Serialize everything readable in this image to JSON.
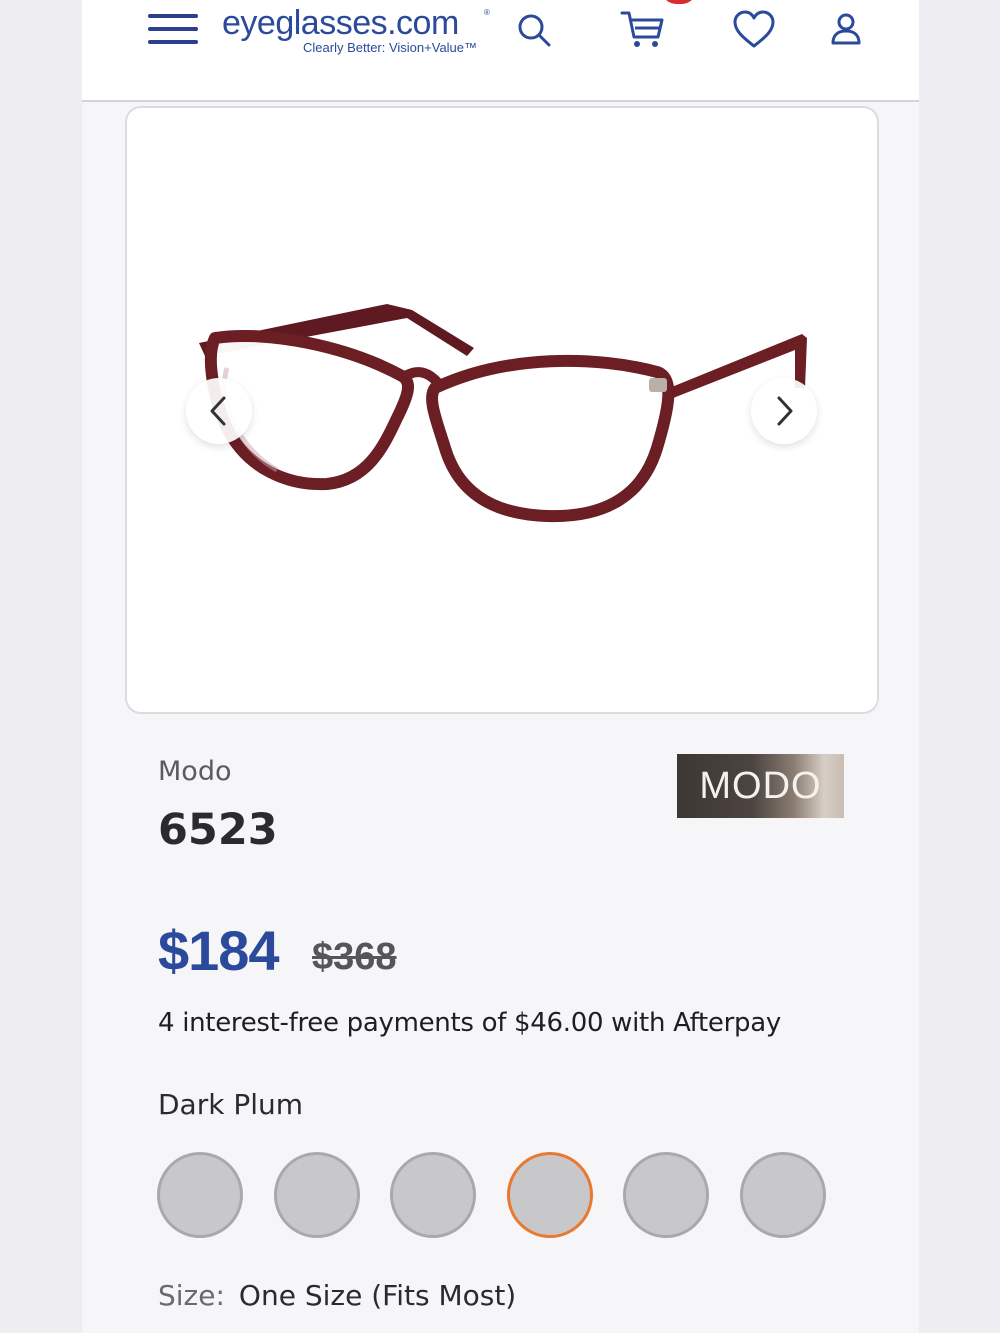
{
  "header": {
    "logo_text": "eyeglasses.com",
    "logo_reg": "®",
    "tagline": "Clearly Better: Vision+Value™"
  },
  "icons": {
    "menu": "menu-icon",
    "search": "search-icon",
    "cart": "cart-icon",
    "wishlist": "heart-icon",
    "account": "user-icon",
    "prev": "chevron-left-icon",
    "next": "chevron-right-icon"
  },
  "product": {
    "brand": "Modo",
    "brand_logo_text": "MODO",
    "model": "6523",
    "price": "$184",
    "original_price": "$368",
    "afterpay_text": "4 interest-free payments of $46.00 with Afterpay",
    "color_name": "Dark Plum",
    "frame_color": "#6b1e24",
    "selected_swatch_color": "#e8792f",
    "size_label": "Size:",
    "size_value": "One Size (Fits Most)"
  },
  "colors": {
    "brand_blue": "#2c4a9c",
    "badge_red": "#d92c2c"
  }
}
